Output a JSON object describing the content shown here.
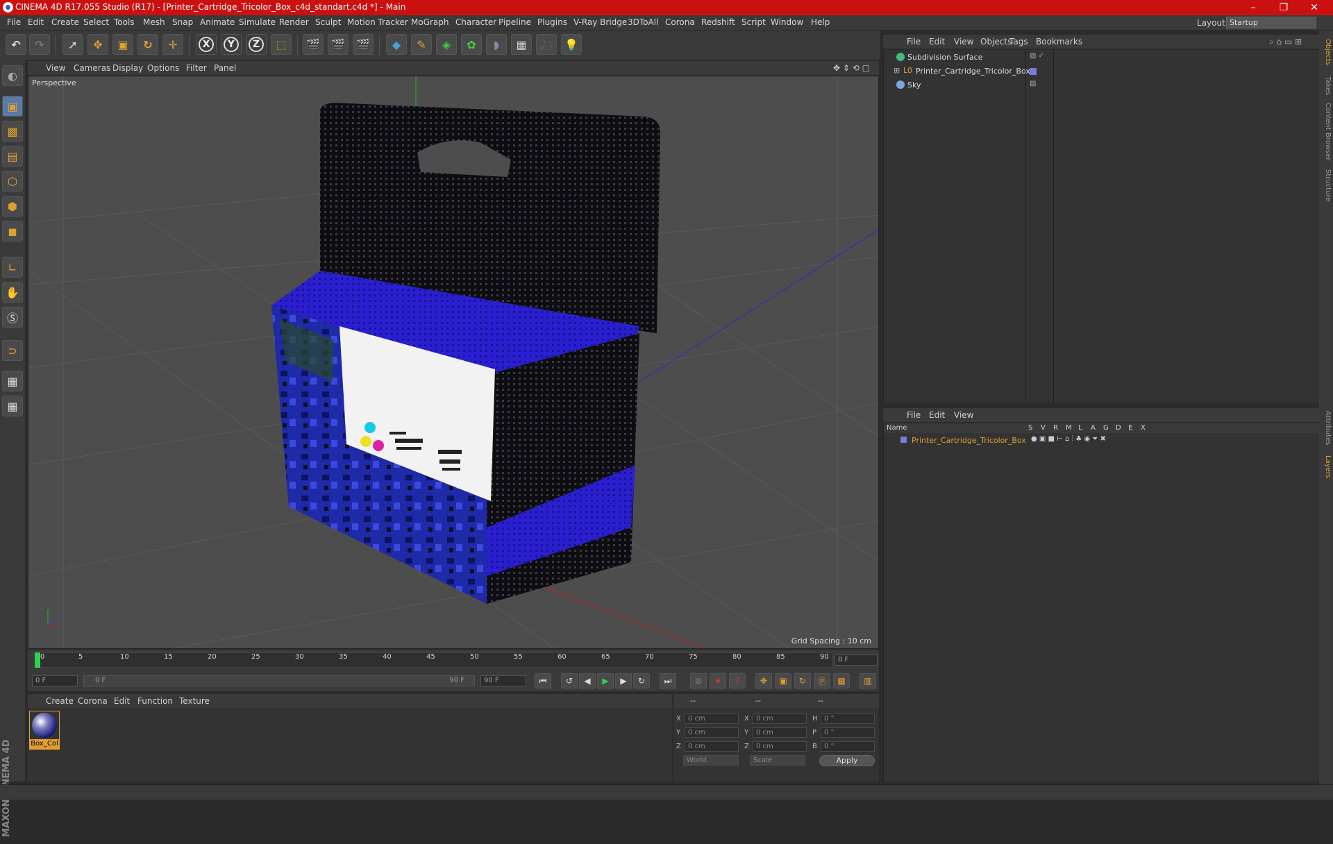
{
  "app": {
    "title": "CINEMA 4D R17.055 Studio (R17) - [Printer_Cartridge_Tricolor_Box_c4d_standart.c4d *] - Main"
  },
  "menubar": {
    "items": [
      "File",
      "Edit",
      "Create",
      "Select",
      "Tools",
      "Mesh",
      "Snap",
      "Animate",
      "Simulate",
      "Render",
      "Sculpt",
      "Motion Tracker",
      "MoGraph",
      "Character",
      "Pipeline",
      "Plugins",
      "V-Ray Bridge",
      "3DToAll",
      "Corona",
      "Redshift",
      "Script",
      "Window",
      "Help"
    ],
    "layout_label": "Layout:",
    "layout_value": "Startup"
  },
  "toolbar": {
    "axis_x": "X",
    "axis_y": "Y",
    "axis_z": "Z"
  },
  "viewport": {
    "menu": [
      "View",
      "Cameras",
      "Display",
      "Options",
      "Filter",
      "Panel"
    ],
    "label": "Perspective",
    "grid_spacing": "Grid Spacing : 10 cm"
  },
  "timeline": {
    "ticks": [
      "0",
      "5",
      "10",
      "15",
      "20",
      "25",
      "30",
      "35",
      "40",
      "45",
      "50",
      "55",
      "60",
      "65",
      "70",
      "75",
      "80",
      "85",
      "90"
    ],
    "current_frame": "0 F",
    "start_field": "0 F",
    "slider_start": "0 F",
    "slider_end": "90 F",
    "end_field": "90 F"
  },
  "material_manager": {
    "menu": [
      "Create",
      "Corona",
      "Edit",
      "Function",
      "Texture"
    ],
    "material_name": "Box_Col"
  },
  "coordinates": {
    "headers": [
      "--",
      "--",
      "--"
    ],
    "rows": [
      {
        "axis": "X",
        "pos": "0 cm",
        "axis2": "X",
        "size": "0 cm",
        "rot_label": "H",
        "rot": "0 °"
      },
      {
        "axis": "Y",
        "pos": "0 cm",
        "axis2": "Y",
        "size": "0 cm",
        "rot_label": "P",
        "rot": "0 °"
      },
      {
        "axis": "Z",
        "pos": "0 cm",
        "axis2": "Z",
        "size": "0 cm",
        "rot_label": "B",
        "rot": "0 °"
      }
    ],
    "mode1": "World",
    "mode2": "Scale",
    "apply": "Apply"
  },
  "object_manager": {
    "menu": [
      "File",
      "Edit",
      "View",
      "Objects",
      "Tags",
      "Bookmarks"
    ],
    "objects": [
      {
        "name": "Subdivision Surface"
      },
      {
        "name": "Printer_Cartridge_Tricolor_Box"
      },
      {
        "name": "Sky"
      }
    ]
  },
  "layer_manager": {
    "menu": [
      "File",
      "Edit",
      "View"
    ],
    "columns": [
      "Name",
      "S",
      "V",
      "R",
      "M",
      "L",
      "A",
      "G",
      "D",
      "E",
      "X"
    ],
    "layers": [
      {
        "name": "Printer_Cartridge_Tricolor_Box",
        "color": "#e0a030"
      }
    ]
  },
  "side_tabs": [
    "Objects",
    "Takes",
    "Content Browser",
    "Structure",
    "Attributes",
    "Layers"
  ],
  "brand": "MAXON CINEMA 4D",
  "colors": {
    "titlebar": "#cc1010",
    "accent": "#e0a030",
    "box_blue": "#2a1fd0"
  }
}
